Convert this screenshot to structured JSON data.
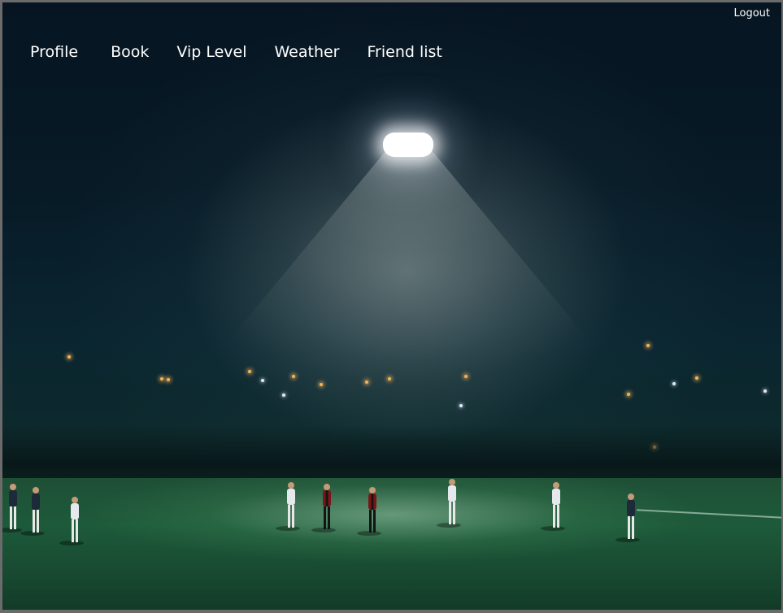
{
  "header": {
    "logout_label": "Logout"
  },
  "nav": {
    "items": [
      {
        "label": "Profile"
      },
      {
        "label": "Book"
      },
      {
        "label": "Vip Level"
      },
      {
        "label": "Weather"
      },
      {
        "label": "Friend list"
      }
    ]
  },
  "background": {
    "image_subject": "night football field with floodlight",
    "colors": {
      "sky": "#061521",
      "grass": "#1d5a3a",
      "text": "#ffffff"
    }
  }
}
